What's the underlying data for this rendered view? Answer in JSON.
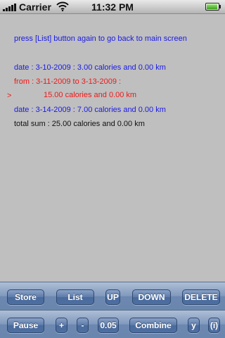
{
  "status_bar": {
    "carrier": "Carrier",
    "time": "11:32 PM"
  },
  "content": {
    "instruction": "press [List] button again to go back to main screen",
    "marker": ">",
    "entries": [
      "date : 3-10-2009 : 3.00 calories and 0.00 km",
      "from : 3-11-2009 to 3-13-2009 :",
      "15.00 calories and 0.00 km",
      "date : 3-14-2009 : 7.00 calories and 0.00 km"
    ],
    "total": "total sum : 25.00 calories and 0.00 km"
  },
  "toolbar_top": {
    "store": "Store",
    "list": "List",
    "up": "UP",
    "down": "DOWN",
    "delete": "DELETE"
  },
  "toolbar_bottom": {
    "pause": "Pause",
    "plus": "+",
    "minus": "-",
    "step_value": "0.05",
    "combine": "Combine",
    "y": "y",
    "info": "(i)"
  },
  "colors": {
    "normal_text": "#1a1ae6",
    "highlight_text": "#f01818",
    "total_text": "#111111",
    "background": "#bfbfbf"
  }
}
